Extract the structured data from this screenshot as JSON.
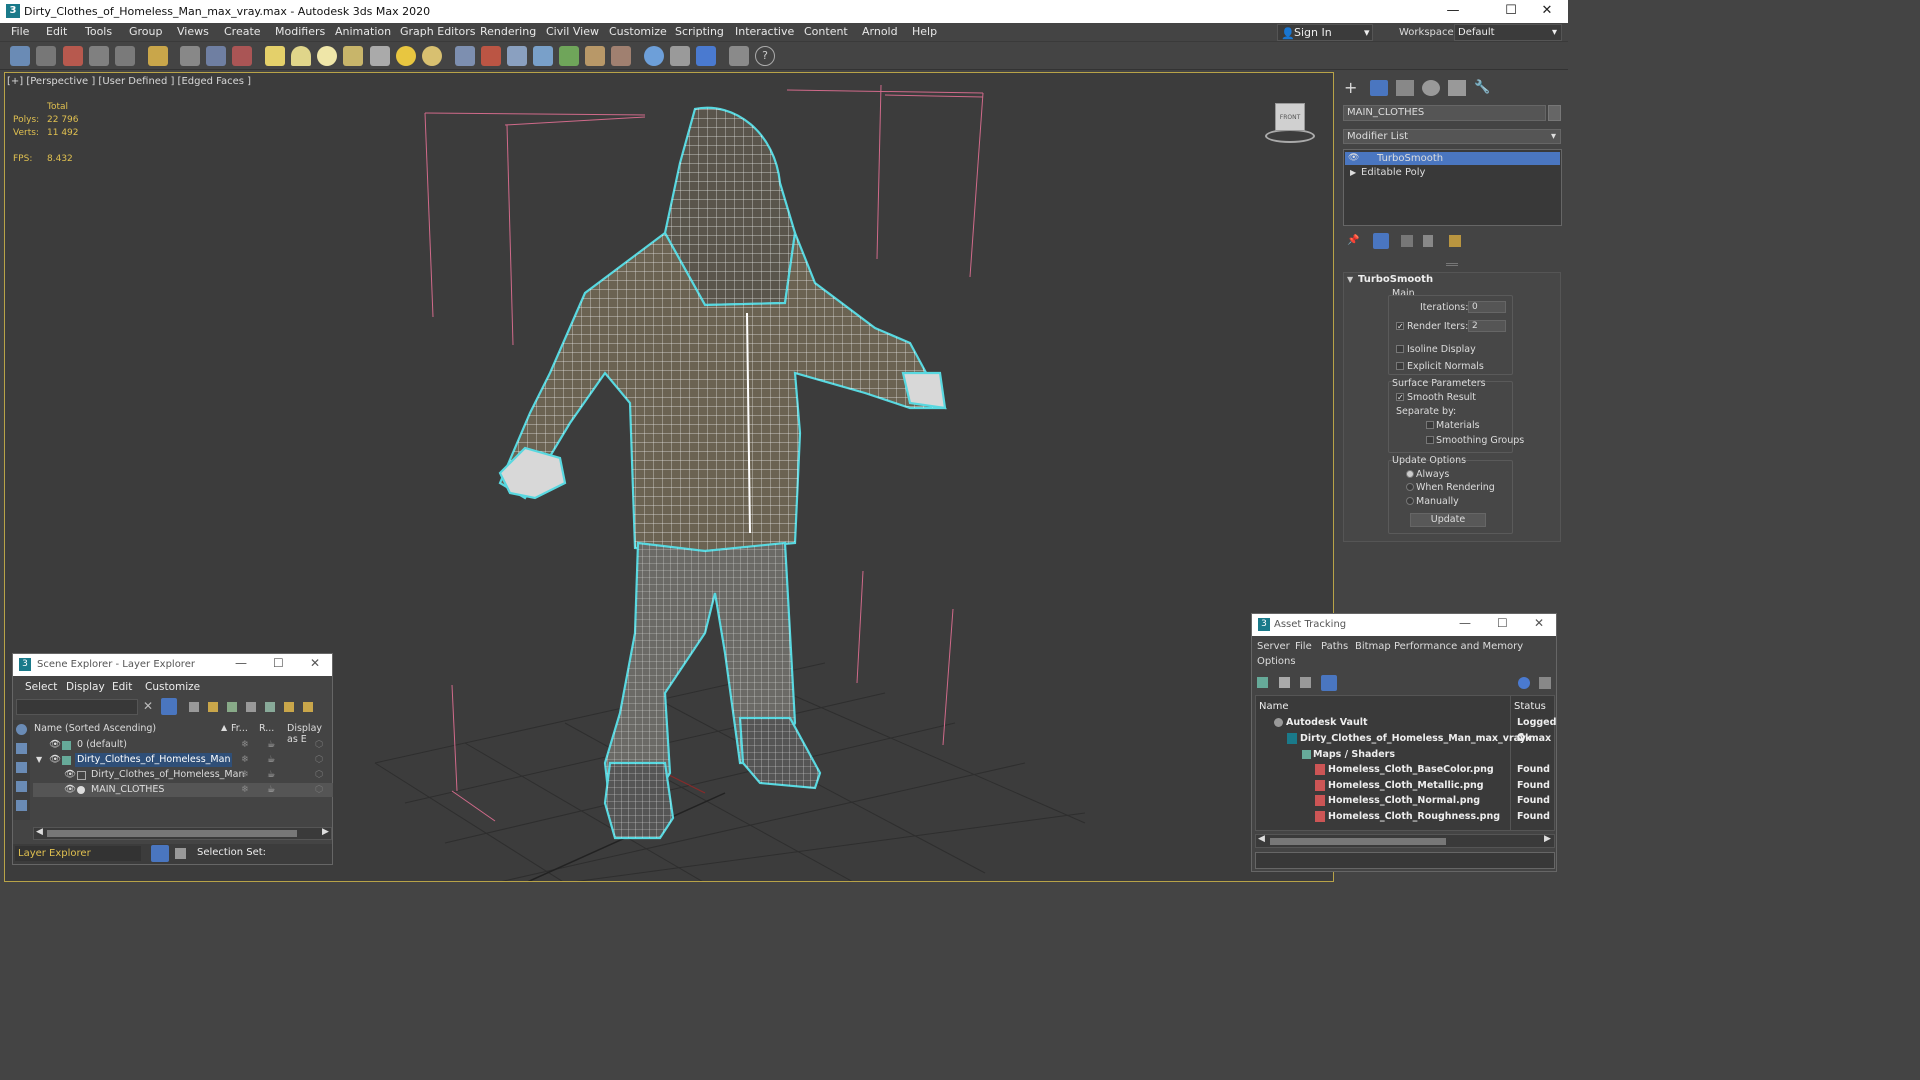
{
  "window": {
    "title": "Dirty_Clothes_of_Homeless_Man_max_vray.max - Autodesk 3ds Max 2020",
    "minimize": "—",
    "maximize": "☐",
    "close": "✕"
  },
  "menu": [
    "File",
    "Edit",
    "Tools",
    "Group",
    "Views",
    "Create",
    "Modifiers",
    "Animation",
    "Graph Editors",
    "Rendering",
    "Civil View",
    "Customize",
    "Scripting",
    "Interactive",
    "Content",
    "Arnold",
    "Help"
  ],
  "signin": {
    "label": "Sign In"
  },
  "workspaces": {
    "label": "Workspaces:",
    "value": "Default"
  },
  "viewport": {
    "label": "[+] [Perspective ] [User Defined ] [Edged Faces ]",
    "stats": {
      "total_label": "Total",
      "polys_label": "Polys:",
      "polys": "22 796",
      "verts_label": "Verts:",
      "verts": "11 492",
      "fps_label": "FPS:",
      "fps": "8.432"
    },
    "viewcube_label": "FRONT"
  },
  "command_panel": {
    "object_name": "MAIN_CLOTHES",
    "modifier_list": "Modifier List",
    "stack": [
      "TurboSmooth",
      "Editable Poly"
    ],
    "rollout_title": "TurboSmooth",
    "main_label": "Main",
    "iterations_label": "Iterations:",
    "iterations": "0",
    "render_iters_label": "Render Iters:",
    "render_iters": "2",
    "isoline_label": "Isoline Display",
    "explicit_label": "Explicit Normals",
    "surface_params_label": "Surface Parameters",
    "smooth_result_label": "Smooth Result",
    "separate_by_label": "Separate by:",
    "materials_label": "Materials",
    "smoothing_groups_label": "Smoothing Groups",
    "update_options_label": "Update Options",
    "always_label": "Always",
    "when_rendering_label": "When Rendering",
    "manually_label": "Manually",
    "update_button": "Update"
  },
  "scene_explorer": {
    "title": "Scene Explorer - Layer Explorer",
    "menu": [
      "Select",
      "Display",
      "Edit",
      "Customize"
    ],
    "columns": {
      "name": "Name (Sorted Ascending)",
      "frozen": "Fr...",
      "render": "R...",
      "display": "Display as E"
    },
    "rows": [
      {
        "name": "0 (default)",
        "indent": 0
      },
      {
        "name": "Dirty_Clothes_of_Homeless_Man",
        "indent": 0
      },
      {
        "name": "Dirty_Clothes_of_Homeless_Man",
        "indent": 1
      },
      {
        "name": "MAIN_CLOTHES",
        "indent": 1
      }
    ],
    "footer_label": "Layer Explorer",
    "selection_set_label": "Selection Set:"
  },
  "asset_tracking": {
    "title": "Asset Tracking",
    "menu": [
      "Server",
      "File",
      "Paths",
      "Bitmap Performance and Memory"
    ],
    "menu2": "Options",
    "col_name": "Name",
    "col_status": "Status",
    "rows": [
      {
        "name": "Autodesk Vault",
        "status": "Logged C"
      },
      {
        "name": "Dirty_Clothes_of_Homeless_Man_max_vray.max",
        "status": "Ok"
      },
      {
        "name": "Maps / Shaders",
        "status": ""
      },
      {
        "name": "Homeless_Cloth_BaseColor.png",
        "status": "Found"
      },
      {
        "name": "Homeless_Cloth_Metallic.png",
        "status": "Found"
      },
      {
        "name": "Homeless_Cloth_Normal.png",
        "status": "Found"
      },
      {
        "name": "Homeless_Cloth_Roughness.png",
        "status": "Found"
      }
    ]
  },
  "colors": {
    "accent": "#5b8fd6",
    "selection": "#4a76c0",
    "stats": "#e0c050",
    "wire": "#58d8e0"
  }
}
